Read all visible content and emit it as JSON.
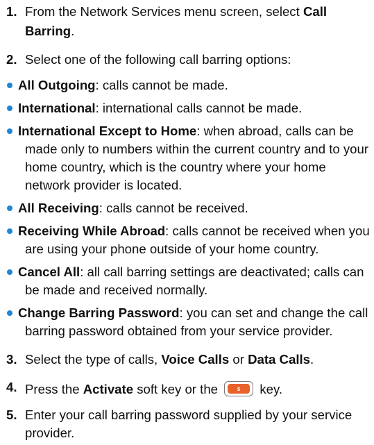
{
  "steps": {
    "s1": {
      "num": "1.",
      "pre": "From the Network Services menu screen, select ",
      "bold": "Call",
      "line2": "Barring",
      "post2": "."
    },
    "s2": {
      "num": "2.",
      "text": "Select one of the following call barring options:"
    },
    "options": [
      {
        "label": "All Outgoing",
        "desc": ": calls cannot be made."
      },
      {
        "label": "International",
        "desc": ": international calls cannot be made."
      },
      {
        "label": "International Except to Home",
        "desc": ": when abroad, calls can be",
        "cont": [
          "made only to numbers within the current country and to your",
          "home country, which is the country where your home",
          "network provider is located."
        ]
      },
      {
        "label": "All Receiving",
        "desc": ": calls cannot be received."
      },
      {
        "label": "Receiving While Abroad",
        "desc": ": calls cannot be received when you",
        "cont": [
          "are using your phone outside of your home country."
        ]
      },
      {
        "label": "Cancel All",
        "desc": ": all call barring settings are deactivated; calls can",
        "cont": [
          "be made and received normally."
        ]
      },
      {
        "label": "Change Barring Password",
        "desc": ": you can set and change the call",
        "cont": [
          "barring password obtained from your service provider."
        ]
      }
    ],
    "s3": {
      "num": "3.",
      "pre": "Select the type of calls, ",
      "b1": "Voice Calls",
      "mid": " or ",
      "b2": "Data Calls",
      "post": "."
    },
    "s4": {
      "num": "4.",
      "pre": "Press the ",
      "bold": "Activate",
      "mid": " soft key or the ",
      "key_glyph": "s",
      "post": " key."
    },
    "s5": {
      "num": "5.",
      "line1": "Enter your call barring password supplied by your service",
      "line2": "provider."
    }
  },
  "colors": {
    "bullet": "#1f86d6",
    "key": "#e9622a"
  }
}
